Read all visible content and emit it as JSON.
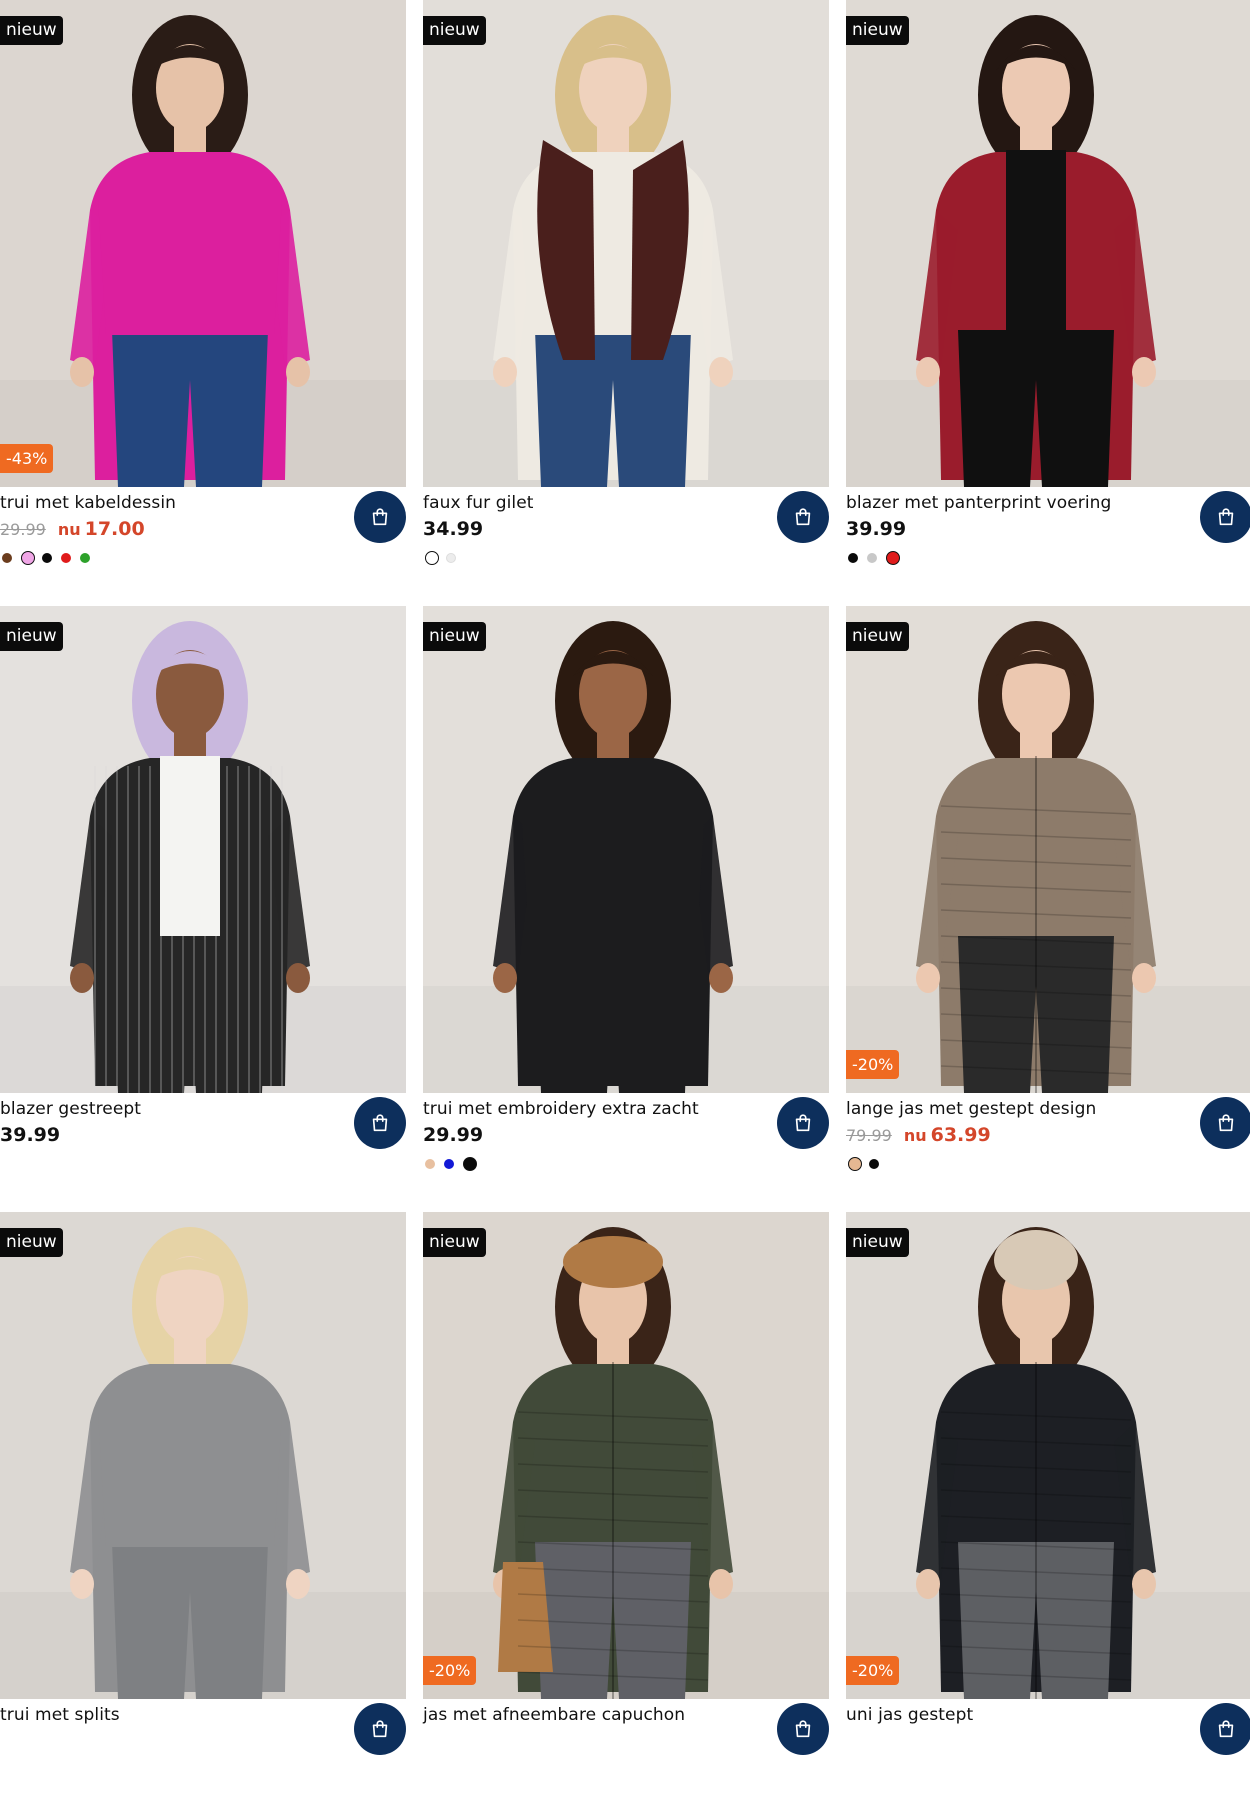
{
  "colors": {
    "cart_button": "#0d2f5c",
    "new_badge": "#0b0b0b",
    "discount_badge": "#ef6a21",
    "sale_price": "#d4462a"
  },
  "cart_icon": "shopping-bag-icon",
  "products": [
    {
      "badge": "nieuw",
      "discount": "-43%",
      "name": "trui met kabeldessin",
      "old_price": "29.99",
      "nu_label": "nu",
      "price": "17.00",
      "swatches": [
        {
          "color": "#6b3d1e",
          "selected": false
        },
        {
          "color": "#f0a6e6",
          "selected": true
        },
        {
          "color": "#0a0a0a",
          "selected": false
        },
        {
          "color": "#e01b1b",
          "selected": false
        },
        {
          "color": "#2da12a",
          "selected": false
        }
      ],
      "photo": {
        "bg": "#dcd6d0",
        "garment": "#dc1f9e",
        "pants": "#24467e",
        "hair": "#2a1c16",
        "skin": "#e6c2a8"
      }
    },
    {
      "badge": "nieuw",
      "discount": "",
      "name": "faux fur gilet",
      "old_price": "",
      "nu_label": "",
      "price": "34.99",
      "swatches": [
        {
          "color": "#ffffff",
          "selected": true
        },
        {
          "color": "#ececec",
          "selected": false
        }
      ],
      "photo": {
        "bg": "#e2ded9",
        "garment": "#eeeae2",
        "pants": "#2a4a7a",
        "hair": "#d8bf8a",
        "skin": "#efd2bd",
        "accent": "#4a1f1c"
      }
    },
    {
      "badge": "nieuw",
      "discount": "",
      "name": "blazer met panterprint voering",
      "old_price": "",
      "nu_label": "",
      "price": "39.99",
      "swatches": [
        {
          "color": "#0a0a0a",
          "selected": false
        },
        {
          "color": "#c8c8c8",
          "selected": false
        },
        {
          "color": "#e01b1b",
          "selected": true
        }
      ],
      "photo": {
        "bg": "#dfdad4",
        "garment": "#9a1c2c",
        "pants": "#101010",
        "hair": "#241712",
        "skin": "#ecc9b3",
        "accent": "#111111"
      }
    },
    {
      "badge": "nieuw",
      "discount": "",
      "name": "blazer gestreept",
      "old_price": "",
      "nu_label": "",
      "price": "39.99",
      "swatches": [],
      "photo": {
        "bg": "#e4e1de",
        "garment": "#262626",
        "pants": "#262626",
        "hair": "#c9b8de",
        "skin": "#8a5a3e",
        "accent": "#f4f4f2"
      }
    },
    {
      "badge": "nieuw",
      "discount": "",
      "name": "trui met embroidery extra zacht",
      "old_price": "",
      "nu_label": "",
      "price": "29.99",
      "swatches": [
        {
          "color": "#e8c0a0",
          "selected": false
        },
        {
          "color": "#1219d6",
          "selected": false
        },
        {
          "color": "#0a0a0a",
          "selected": true
        }
      ],
      "photo": {
        "bg": "#e3dfda",
        "garment": "#1c1c1e",
        "pants": "#1c1c1e",
        "hair": "#2b1a10",
        "skin": "#9b6646"
      }
    },
    {
      "badge": "nieuw",
      "discount": "-20%",
      "name": "lange jas met gestept design",
      "old_price": "79.99",
      "nu_label": "nu",
      "price": "63.99",
      "swatches": [
        {
          "color": "#e5b892",
          "selected": true
        },
        {
          "color": "#0a0a0a",
          "selected": false
        }
      ],
      "photo": {
        "bg": "#e2ddd7",
        "garment": "#8d7b6a",
        "pants": "#2a2a2a",
        "hair": "#3a2418",
        "skin": "#ecc8b0"
      }
    },
    {
      "badge": "nieuw",
      "discount": "",
      "name": "trui met splits",
      "old_price": "",
      "nu_label": "",
      "price": "",
      "swatches": [],
      "photo": {
        "bg": "#dcd8d3",
        "garment": "#8e8f91",
        "pants": "#7e8083",
        "hair": "#e6d3a6",
        "skin": "#efd4c2"
      }
    },
    {
      "badge": "nieuw",
      "discount": "-20%",
      "name": "jas met afneembare capuchon",
      "old_price": "",
      "nu_label": "",
      "price": "",
      "swatches": [],
      "photo": {
        "bg": "#dcd6cf",
        "garment": "#414a39",
        "pants": "#5f6066",
        "hair": "#3a2418",
        "skin": "#e8c4aa",
        "accent": "#b07a45"
      }
    },
    {
      "badge": "nieuw",
      "discount": "-20%",
      "name": "uni jas gestept",
      "old_price": "",
      "nu_label": "",
      "price": "",
      "swatches": [],
      "photo": {
        "bg": "#dedad5",
        "garment": "#1d1f24",
        "pants": "#5d5f63",
        "hair": "#3a2418",
        "skin": "#e8c6ad",
        "accent": "#d8c9b6"
      }
    }
  ]
}
